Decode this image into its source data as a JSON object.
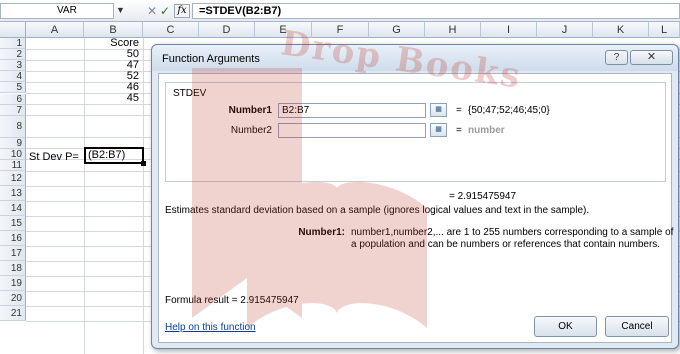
{
  "formula_bar": {
    "name_box": "VAR",
    "cancel_symbol": "✕",
    "enter_symbol": "✓",
    "fx_symbol": "fx",
    "formula": "=STDEV(B2:B7)"
  },
  "sheet": {
    "columns": [
      "A",
      "B",
      "C",
      "D",
      "E",
      "F",
      "G",
      "H",
      "I",
      "J",
      "K",
      "L"
    ],
    "rows": [
      "1",
      "2",
      "3",
      "4",
      "5",
      "6",
      "7",
      "8",
      "9",
      "10",
      "11",
      "12",
      "13",
      "14",
      "15",
      "16",
      "17",
      "18",
      "19",
      "20",
      "21"
    ],
    "cells": {
      "B1": "Score",
      "B2": "50",
      "B3": "47",
      "B4": "52",
      "B5": "46",
      "B6": "45",
      "A8": "St Dev P=",
      "B8": "(B2:B7)"
    }
  },
  "dialog": {
    "title": "Function Arguments",
    "help_symbol": "?",
    "close_symbol": "✕",
    "function_name": "STDEV",
    "args": [
      {
        "label": "Number1",
        "value": "B2:B7",
        "result": "{50;47;52;46;45;0}"
      },
      {
        "label": "Number2",
        "value": "",
        "result": "number"
      }
    ],
    "equals": "=",
    "result_line": "=  2.915475947",
    "description": "Estimates standard deviation based on a sample (ignores logical values and text in the sample).",
    "arg_help_label": "Number1:",
    "arg_help_text": "number1,number2,... are 1 to 255 numbers corresponding to a sample of a population and can be numbers or references that contain numbers.",
    "formula_result": "Formula result =  2.915475947",
    "help_link": "Help on this function",
    "ok_label": "OK",
    "cancel_label": "Cancel"
  },
  "watermark_text": "Drop Books",
  "colors": {
    "dialog_bg": "#dfe8f3",
    "header_border": "#9eb1cc",
    "link": "#0b3e9a",
    "watermark": "#c0392b"
  }
}
